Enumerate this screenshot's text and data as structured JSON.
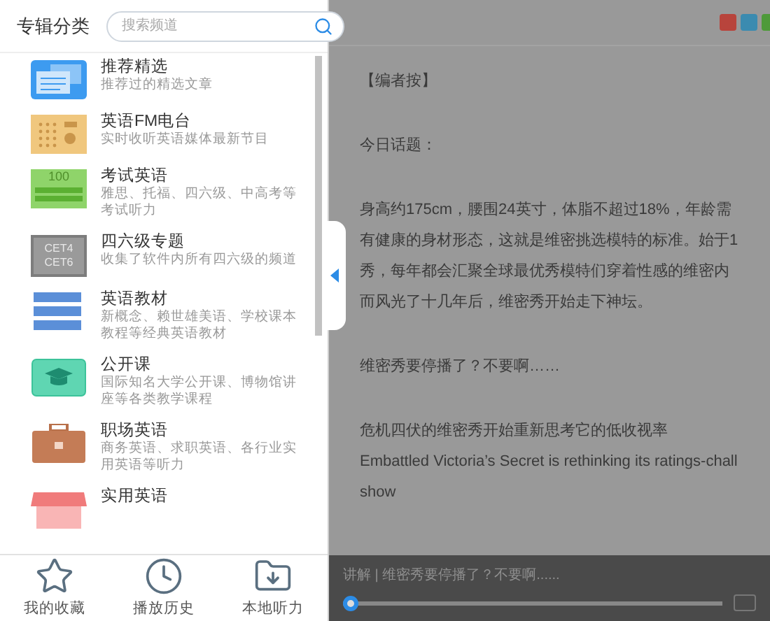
{
  "sidebar": {
    "title": "专辑分类",
    "search": {
      "placeholder": "搜索频道"
    },
    "categories": [
      {
        "kind": "picks",
        "title": "推荐精选",
        "description": "推荐过的精选文章"
      },
      {
        "kind": "radio",
        "title": "英语FM电台",
        "description": "实时收听英语媒体最新节目"
      },
      {
        "kind": "exam",
        "title": "考试英语",
        "description": "雅思、托福、四六级、中高考等考试听力",
        "icon_text": "100"
      },
      {
        "kind": "cet",
        "title": "四六级专题",
        "description": "收集了软件内所有四六级的频道",
        "icon_text": [
          "CET4",
          "CET6"
        ]
      },
      {
        "kind": "books",
        "title": "英语教材",
        "description": "新概念、赖世雄美语、学校课本教程等经典英语教材"
      },
      {
        "kind": "course",
        "title": "公开课",
        "description": "国际知名大学公开课、博物馆讲座等各类教学课程"
      },
      {
        "kind": "job",
        "title": "职场英语",
        "description": "商务英语、求职英语、各行业实用英语等听力"
      },
      {
        "kind": "shop",
        "title": "实用英语"
      }
    ],
    "bottom_nav": [
      {
        "kind": "favorites",
        "label": "我的收藏"
      },
      {
        "kind": "history",
        "label": "播放历史"
      },
      {
        "kind": "local",
        "label": "本地听力"
      }
    ]
  },
  "article": {
    "paragraphs": [
      [
        "【编者按】"
      ],
      [
        "今日话题："
      ],
      [
        "身高约175cm，腰围24英寸，体脂不超过18%，年龄需",
        "有健康的身材形态，这就是维密挑选模特的标准。始于1",
        "秀，每年都会汇聚全球最优秀模特们穿着性感的维密内",
        "而风光了十几年后，维密秀开始走下神坛。"
      ],
      [
        "维密秀要停播了？不要啊……"
      ],
      [
        "危机四伏的维密秀开始重新思考它的低收视率",
        "Embattled Victoria’s Secret is rethinking its ratings-chall",
        "show"
      ]
    ]
  },
  "player": {
    "title": "讲解 | 维密秀要停播了？不要啊......",
    "level": 0.0
  }
}
